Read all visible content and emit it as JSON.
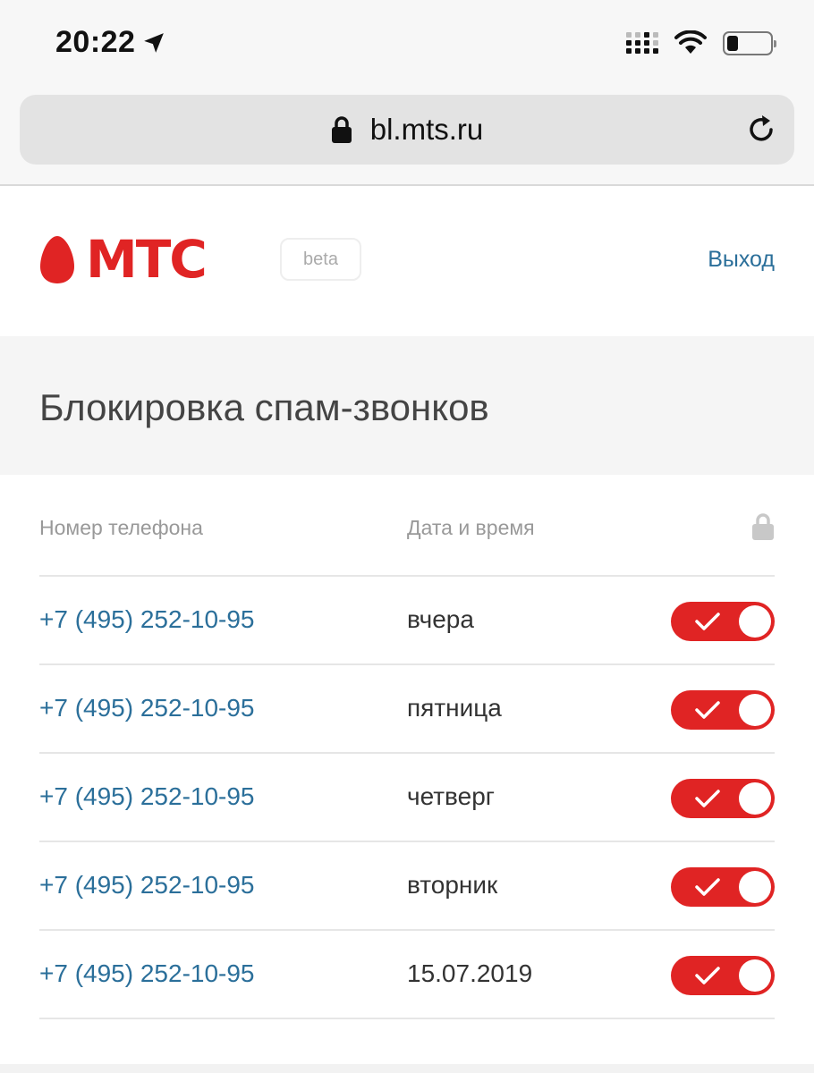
{
  "status_bar": {
    "time": "20:22"
  },
  "browser": {
    "url": "bl.mts.ru"
  },
  "header": {
    "brand": "МТС",
    "beta_label": "beta",
    "logout_label": "Выход",
    "brand_color": "#e02424",
    "link_color": "#2b6f9a"
  },
  "page": {
    "title": "Блокировка спам-звонков"
  },
  "table": {
    "columns": {
      "phone": "Номер телефона",
      "datetime": "Дата и время"
    },
    "rows": [
      {
        "phone": "+7 (495) 252-10-95",
        "date": "вчера",
        "blocked": true
      },
      {
        "phone": "+7 (495) 252-10-95",
        "date": "пятница",
        "blocked": true
      },
      {
        "phone": "+7 (495) 252-10-95",
        "date": "четверг",
        "blocked": true
      },
      {
        "phone": "+7 (495) 252-10-95",
        "date": "вторник",
        "blocked": true
      },
      {
        "phone": "+7 (495) 252-10-95",
        "date": "15.07.2019",
        "blocked": true
      }
    ]
  }
}
